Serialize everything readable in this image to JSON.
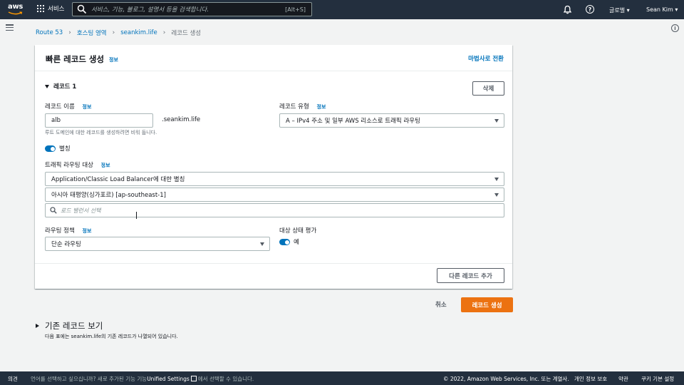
{
  "topnav": {
    "logo": "aws",
    "services": "서비스",
    "search_placeholder": "서비스, 기능, 블로그, 설명서 등을 검색합니다.",
    "search_shortcut": "[Alt+S]",
    "region": "글로벌 ▾",
    "user": "Sean Kim ▾"
  },
  "breadcrumb": {
    "items": [
      "Route 53",
      "호스팅 영역",
      "seankim.life"
    ],
    "current": "레코드 생성"
  },
  "card": {
    "title": "빠른 레코드 생성",
    "info": "정보",
    "wizard_link": "마법사로 전환",
    "record_section": "레코드 1",
    "delete_button": "삭제",
    "record_name_label": "레코드 이름",
    "record_name_value": "alb",
    "record_name_suffix": ".seankim.life",
    "record_name_hint": "루트 도메인에 대한 레코드를 생성하려면 비워 둡니다.",
    "record_type_label": "레코드 유형",
    "record_type_value": "A – IPv4 주소 및 일부 AWS 리소스로 트래픽 라우팅",
    "alias_label": "별칭",
    "route_target_label": "트래픽 라우팅 대상",
    "route_target_value": "Application/Classic Load Balancer에 대한 별칭",
    "region_value": "아시아 태평양(싱가포르) [ap-southeast-1]",
    "lb_search_placeholder": "로드 밸런서 선택",
    "routing_policy_label": "라우팅 정책",
    "routing_policy_value": "단순 라우팅",
    "health_label": "대상 상태 평가",
    "health_value": "예",
    "add_record_button": "다른 레코드 추가"
  },
  "actions": {
    "cancel": "취소",
    "create": "레코드 생성"
  },
  "existing": {
    "title": "기존 레코드 보기",
    "desc": "다음 표에는 seankim.life의 기존 레코드가 나열되어 있습니다."
  },
  "footer": {
    "feedback": "의견",
    "lang_prefix": "언어를 선택하고 싶으십니까? 새로 추가된 기능 기능",
    "lang_link": "Unified Settings",
    "lang_suffix": "에서 선택할 수 있습니다.",
    "copyright": "© 2022, Amazon Web Services, Inc. 또는 계열사.",
    "privacy": "개인 정보 보호",
    "terms": "약관",
    "cookies": "쿠키 기본 설정"
  },
  "colors": {
    "nav_bg": "#232f3e",
    "link": "#0073bb",
    "primary_button": "#ec7211",
    "page_bg": "#f2f3f3"
  }
}
